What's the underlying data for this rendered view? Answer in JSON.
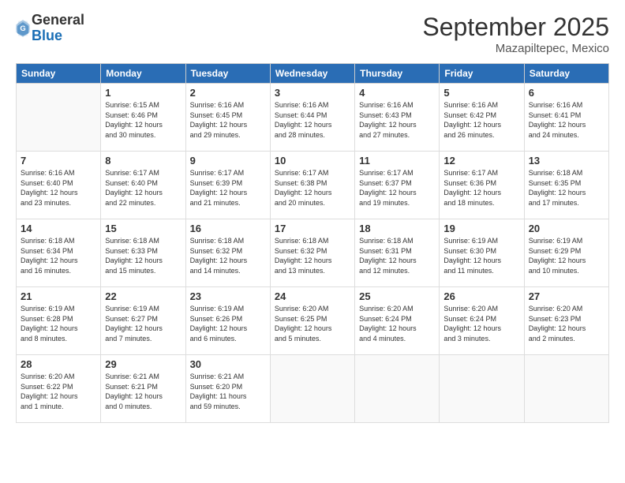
{
  "logo": {
    "general": "General",
    "blue": "Blue"
  },
  "header": {
    "month": "September 2025",
    "location": "Mazapiltepec, Mexico"
  },
  "weekdays": [
    "Sunday",
    "Monday",
    "Tuesday",
    "Wednesday",
    "Thursday",
    "Friday",
    "Saturday"
  ],
  "weeks": [
    [
      {
        "day": "",
        "info": ""
      },
      {
        "day": "1",
        "info": "Sunrise: 6:15 AM\nSunset: 6:46 PM\nDaylight: 12 hours\nand 30 minutes."
      },
      {
        "day": "2",
        "info": "Sunrise: 6:16 AM\nSunset: 6:45 PM\nDaylight: 12 hours\nand 29 minutes."
      },
      {
        "day": "3",
        "info": "Sunrise: 6:16 AM\nSunset: 6:44 PM\nDaylight: 12 hours\nand 28 minutes."
      },
      {
        "day": "4",
        "info": "Sunrise: 6:16 AM\nSunset: 6:43 PM\nDaylight: 12 hours\nand 27 minutes."
      },
      {
        "day": "5",
        "info": "Sunrise: 6:16 AM\nSunset: 6:42 PM\nDaylight: 12 hours\nand 26 minutes."
      },
      {
        "day": "6",
        "info": "Sunrise: 6:16 AM\nSunset: 6:41 PM\nDaylight: 12 hours\nand 24 minutes."
      }
    ],
    [
      {
        "day": "7",
        "info": "Sunrise: 6:16 AM\nSunset: 6:40 PM\nDaylight: 12 hours\nand 23 minutes."
      },
      {
        "day": "8",
        "info": "Sunrise: 6:17 AM\nSunset: 6:40 PM\nDaylight: 12 hours\nand 22 minutes."
      },
      {
        "day": "9",
        "info": "Sunrise: 6:17 AM\nSunset: 6:39 PM\nDaylight: 12 hours\nand 21 minutes."
      },
      {
        "day": "10",
        "info": "Sunrise: 6:17 AM\nSunset: 6:38 PM\nDaylight: 12 hours\nand 20 minutes."
      },
      {
        "day": "11",
        "info": "Sunrise: 6:17 AM\nSunset: 6:37 PM\nDaylight: 12 hours\nand 19 minutes."
      },
      {
        "day": "12",
        "info": "Sunrise: 6:17 AM\nSunset: 6:36 PM\nDaylight: 12 hours\nand 18 minutes."
      },
      {
        "day": "13",
        "info": "Sunrise: 6:18 AM\nSunset: 6:35 PM\nDaylight: 12 hours\nand 17 minutes."
      }
    ],
    [
      {
        "day": "14",
        "info": "Sunrise: 6:18 AM\nSunset: 6:34 PM\nDaylight: 12 hours\nand 16 minutes."
      },
      {
        "day": "15",
        "info": "Sunrise: 6:18 AM\nSunset: 6:33 PM\nDaylight: 12 hours\nand 15 minutes."
      },
      {
        "day": "16",
        "info": "Sunrise: 6:18 AM\nSunset: 6:32 PM\nDaylight: 12 hours\nand 14 minutes."
      },
      {
        "day": "17",
        "info": "Sunrise: 6:18 AM\nSunset: 6:32 PM\nDaylight: 12 hours\nand 13 minutes."
      },
      {
        "day": "18",
        "info": "Sunrise: 6:18 AM\nSunset: 6:31 PM\nDaylight: 12 hours\nand 12 minutes."
      },
      {
        "day": "19",
        "info": "Sunrise: 6:19 AM\nSunset: 6:30 PM\nDaylight: 12 hours\nand 11 minutes."
      },
      {
        "day": "20",
        "info": "Sunrise: 6:19 AM\nSunset: 6:29 PM\nDaylight: 12 hours\nand 10 minutes."
      }
    ],
    [
      {
        "day": "21",
        "info": "Sunrise: 6:19 AM\nSunset: 6:28 PM\nDaylight: 12 hours\nand 8 minutes."
      },
      {
        "day": "22",
        "info": "Sunrise: 6:19 AM\nSunset: 6:27 PM\nDaylight: 12 hours\nand 7 minutes."
      },
      {
        "day": "23",
        "info": "Sunrise: 6:19 AM\nSunset: 6:26 PM\nDaylight: 12 hours\nand 6 minutes."
      },
      {
        "day": "24",
        "info": "Sunrise: 6:20 AM\nSunset: 6:25 PM\nDaylight: 12 hours\nand 5 minutes."
      },
      {
        "day": "25",
        "info": "Sunrise: 6:20 AM\nSunset: 6:24 PM\nDaylight: 12 hours\nand 4 minutes."
      },
      {
        "day": "26",
        "info": "Sunrise: 6:20 AM\nSunset: 6:24 PM\nDaylight: 12 hours\nand 3 minutes."
      },
      {
        "day": "27",
        "info": "Sunrise: 6:20 AM\nSunset: 6:23 PM\nDaylight: 12 hours\nand 2 minutes."
      }
    ],
    [
      {
        "day": "28",
        "info": "Sunrise: 6:20 AM\nSunset: 6:22 PM\nDaylight: 12 hours\nand 1 minute."
      },
      {
        "day": "29",
        "info": "Sunrise: 6:21 AM\nSunset: 6:21 PM\nDaylight: 12 hours\nand 0 minutes."
      },
      {
        "day": "30",
        "info": "Sunrise: 6:21 AM\nSunset: 6:20 PM\nDaylight: 11 hours\nand 59 minutes."
      },
      {
        "day": "",
        "info": ""
      },
      {
        "day": "",
        "info": ""
      },
      {
        "day": "",
        "info": ""
      },
      {
        "day": "",
        "info": ""
      }
    ]
  ]
}
